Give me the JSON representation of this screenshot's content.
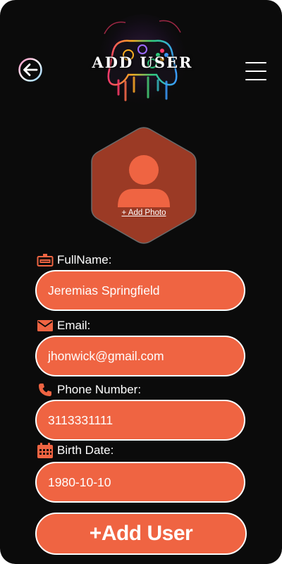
{
  "header": {
    "title": "Add User",
    "back_icon": "arrow-left-circle-icon",
    "menu_icon": "hamburger-menu-icon",
    "art_icon": "neon-gamepad-logo"
  },
  "avatar": {
    "icon": "user-silhouette-icon",
    "add_photo_label": "+ Add Photo"
  },
  "form": {
    "fullname": {
      "label": "FullName:",
      "value": "Jeremias Springfield",
      "icon": "id-card-icon"
    },
    "email": {
      "label": "Email:",
      "value": "jhonwick@gmail.com",
      "icon": "envelope-icon"
    },
    "phone": {
      "label": "Phone Number:",
      "value": "3113331111",
      "icon": "phone-icon"
    },
    "birth": {
      "label": "Birth Date:",
      "value": "1980-10-10",
      "icon": "calendar-icon"
    }
  },
  "submit_label": "+Add User",
  "colors": {
    "background": "#0b0b0b",
    "accent": "#ef6442",
    "avatar_fill": "#9b3a25",
    "text": "#ffffff"
  }
}
